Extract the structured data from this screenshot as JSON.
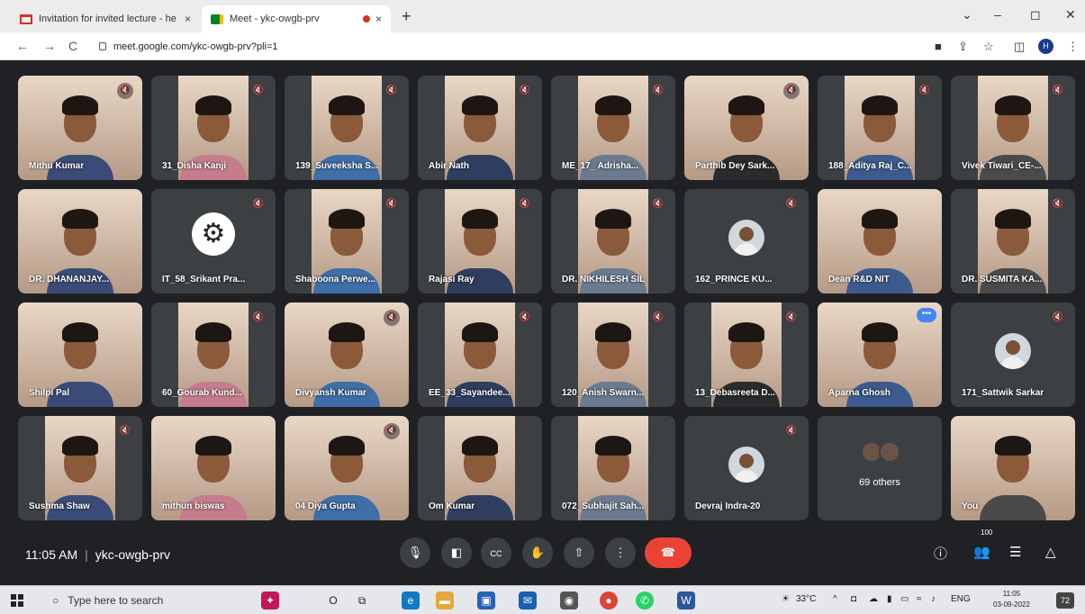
{
  "tabs": [
    {
      "title": "Invitation for invited lecture - he",
      "close": "×",
      "favicon": "gmail-icon"
    },
    {
      "title": "Meet - ykc-owgb-prv",
      "close": "×",
      "favicon": "meet-icon"
    }
  ],
  "new_tab": "+",
  "window_controls": {
    "menu": "⌄",
    "minimize": "–",
    "maximize": "◻",
    "close": "✕"
  },
  "address": {
    "url": "meet.google.com/ykc-owgb-prv?pli=1"
  },
  "profile_initial": "H",
  "participants": [
    {
      "name": "Mithu Kumar",
      "mic": "muted"
    },
    {
      "name": "31_Disha Kanji",
      "mic": "muted"
    },
    {
      "name": "139_Suveeksha S...",
      "mic": "muted"
    },
    {
      "name": "Abir Nath",
      "mic": "muted"
    },
    {
      "name": "ME_17_ Adrisha...",
      "mic": "muted"
    },
    {
      "name": "Parthib Dey Sark...",
      "mic": "muted"
    },
    {
      "name": "188_Aditya Raj_C...",
      "mic": "muted"
    },
    {
      "name": "Vivek Tiwari_CE-...",
      "mic": "muted"
    },
    {
      "name": "DR. DHANANJAY...",
      "mic": ""
    },
    {
      "name": "IT_58_Srikant Pra...",
      "mic": "muted"
    },
    {
      "name": "Shaboona Perwe...",
      "mic": "muted"
    },
    {
      "name": "Rajasi Ray",
      "mic": "muted"
    },
    {
      "name": "DR. NIKHILESH SIL",
      "mic": "muted"
    },
    {
      "name": "162_PRINCE KU...",
      "mic": "muted"
    },
    {
      "name": "Dean R&D NIT",
      "mic": ""
    },
    {
      "name": "DR. SUSMITA KA...",
      "mic": "muted"
    },
    {
      "name": "Shilpi Pal",
      "mic": ""
    },
    {
      "name": "60_Gourab Kund...",
      "mic": "muted"
    },
    {
      "name": "Divyansh Kumar",
      "mic": "muted"
    },
    {
      "name": "EE_33_Sayandee...",
      "mic": "muted"
    },
    {
      "name": "120_Anish Swarn...",
      "mic": "muted"
    },
    {
      "name": "13_Debasreeta D...",
      "mic": "muted"
    },
    {
      "name": "Aparna Ghosh",
      "mic": ""
    },
    {
      "name": "171_Sattwik Sarkar",
      "mic": "muted"
    },
    {
      "name": "Sushma Shaw",
      "mic": "muted"
    },
    {
      "name": "mithun biswas",
      "mic": ""
    },
    {
      "name": "04 Diya Gupta",
      "mic": "muted"
    },
    {
      "name": "Om Kumar",
      "mic": ""
    },
    {
      "name": "072_Subhajit Sah...",
      "mic": ""
    },
    {
      "name": "Devraj Indra-20",
      "mic": "muted"
    },
    {
      "name": "69 others",
      "mic": ""
    },
    {
      "name": "You",
      "mic": ""
    }
  ],
  "meeting": {
    "time": "11:05 AM",
    "code": "ykc-owgb-prv",
    "participant_count": "100"
  },
  "controls": [
    "mic-icon",
    "camera-icon",
    "captions-icon",
    "raise-hand-icon",
    "present-icon",
    "more-icon",
    "end-call-icon"
  ],
  "right_controls": [
    "info-icon",
    "people-icon",
    "chat-icon",
    "activities-icon"
  ],
  "taskbar": {
    "search_placeholder": "Type here to search",
    "weather": "33°C",
    "language": "ENG",
    "clock_time": "11:05",
    "clock_date": "03-09-2022",
    "notification_count": "72"
  },
  "colors": {
    "meet_bg": "#202124",
    "tile_bg": "#3c4043",
    "end_call": "#ea4335",
    "active": "#8ab4f8"
  }
}
